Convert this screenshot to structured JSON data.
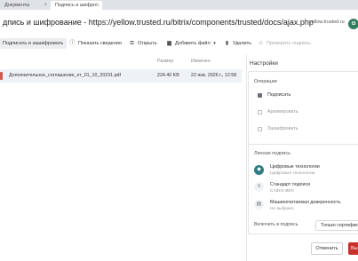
{
  "tabs": [
    {
      "label": "Документы",
      "close": "×"
    },
    {
      "label": "Подпись и шифро...",
      "close": "×"
    }
  ],
  "titlebar": {
    "title": "дпись и шифрование - https://yellow.trusted.ru/bitrix/components/trusted/docs/ajax.php",
    "domain": "yellow.trusted.ru"
  },
  "toolbar": {
    "sign_encrypt": "Подписать и зашифровать",
    "show_info": "Показать сведения",
    "open": "Открыть",
    "add_file": "Добавить файл",
    "add_file_caret": "▾",
    "delete": "Удалить",
    "verify": "Проверить подпись"
  },
  "table": {
    "headers": {
      "name": "",
      "size": "Размер",
      "modified": "Изменен"
    },
    "rows": [
      {
        "name": "Дополнительное_соглашение_от_01_10_20231.pdf",
        "size": "224.40 KB",
        "modified": "22 янв. 2026 г., 12:58"
      }
    ]
  },
  "settings": {
    "heading": "Настройки",
    "operations_label": "Операции",
    "operations": [
      {
        "label": "Подписать",
        "checked": true
      },
      {
        "label": "Архивировать",
        "checked": false
      },
      {
        "label": "Зашифровать",
        "checked": false
      }
    ],
    "signature": {
      "label": "Личная подпись",
      "certificate": {
        "title": "Цифровые технологии",
        "subtitle": "Цифровые технологии"
      },
      "standard": {
        "title": "Стандарт подписи",
        "subtitle": "CAdES-BES"
      },
      "proxy": {
        "title": "Машиночитаемая доверенность",
        "subtitle": "Не выбрано"
      },
      "include_label": "Включить в подпись",
      "include_value": "Только сертификат"
    }
  },
  "footer": {
    "cancel": "Отменить",
    "execute": "Выполнить"
  },
  "colors": {
    "accent": "#2d7d82",
    "danger": "#c9302c",
    "selected_row": "#eef1f5"
  }
}
